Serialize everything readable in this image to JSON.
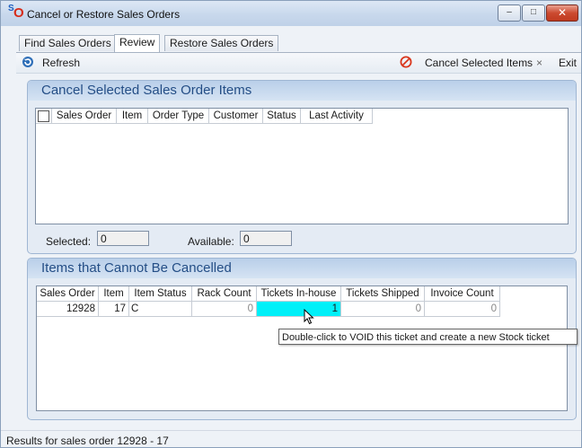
{
  "window": {
    "title": "Cancel or Restore Sales Orders"
  },
  "title_buttons": {
    "minimize": "–",
    "maximize": "□",
    "close": "✕"
  },
  "tabs": [
    "Find Sales Orders",
    "Review",
    "Restore Sales Orders"
  ],
  "toolbar": {
    "refresh_label": "Refresh",
    "cancel_label": "Cancel Selected Items",
    "exit_icon": "×",
    "exit_label": "Exit"
  },
  "cancel_panel": {
    "title": "Cancel Selected Sales Order Items",
    "columns": [
      "Sales Order",
      "Item",
      "Order Type",
      "Customer",
      "Status",
      "Last Activity"
    ],
    "selected_label": "Selected:",
    "selected_value": "0",
    "available_label": "Available:",
    "available_value": "0"
  },
  "blocked_panel": {
    "title": "Items that Cannot Be Cancelled",
    "columns": [
      "Sales Order",
      "Item",
      "Item Status",
      "Rack Count",
      "Tickets In-house",
      "Tickets Shipped",
      "Invoice Count"
    ],
    "rows": [
      {
        "sales_order": "12928",
        "item": "17",
        "item_status": "C",
        "rack_count": "0",
        "tickets_in_house": "1",
        "tickets_shipped": "0",
        "invoice_count": "0"
      }
    ]
  },
  "tooltip": "Double-click to VOID this ticket and create a new Stock ticket",
  "status": "Results for sales order 12928 - 17",
  "colors": {
    "highlight_cell": "#00f0f8",
    "panel_title": "#244e86",
    "cancel_icon": "#d9361c"
  }
}
